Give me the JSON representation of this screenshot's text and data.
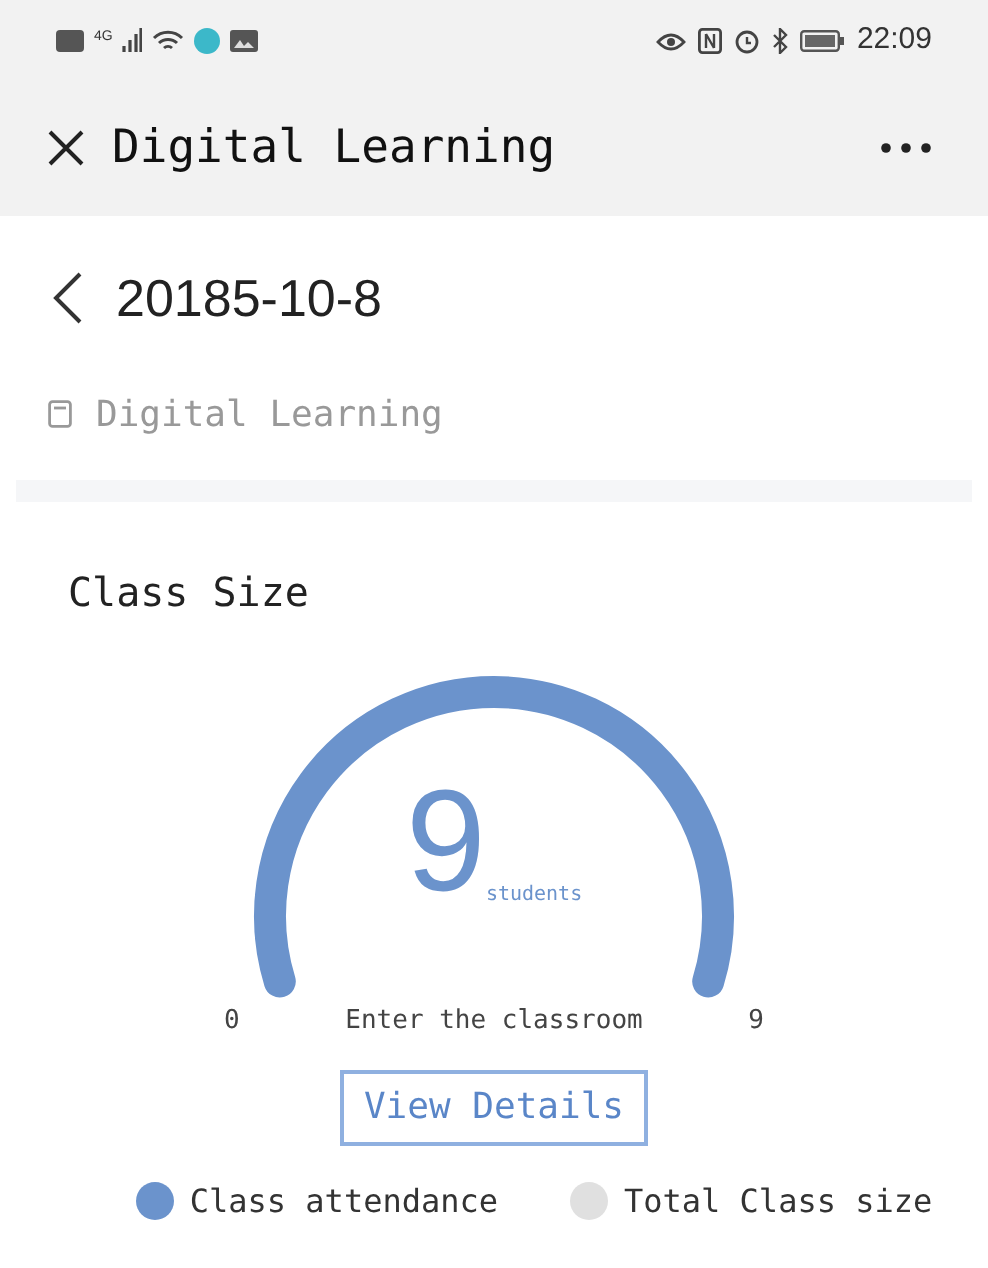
{
  "status_bar": {
    "network": "4G",
    "time": "22:09"
  },
  "header": {
    "title": "Digital Learning"
  },
  "date": "20185-10-8",
  "course": "Digital Learning",
  "card": {
    "title": "Class Size",
    "gauge": {
      "value": "9",
      "unit": "students",
      "min": "0",
      "max": "9",
      "caption": "Enter the classroom"
    },
    "button": "View Details",
    "legend": [
      {
        "label": "Class attendance",
        "color": "#6b93cc"
      },
      {
        "label": "Total Class size",
        "color": "#e0e0e0"
      }
    ]
  }
}
